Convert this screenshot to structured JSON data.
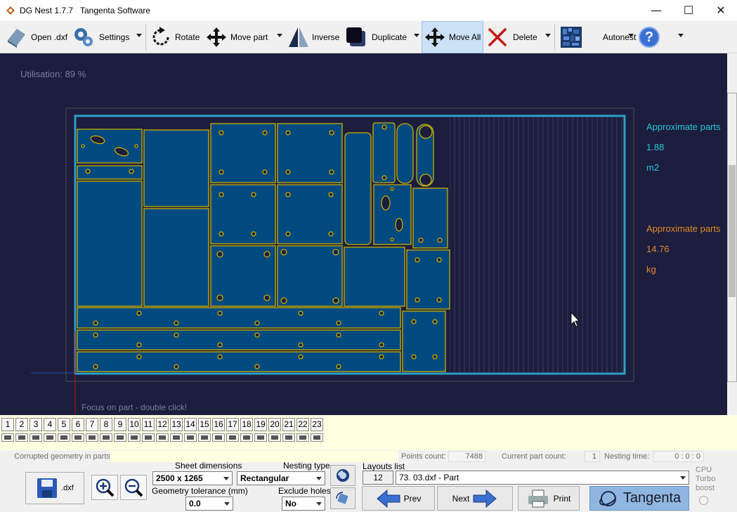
{
  "window": {
    "app_title": "DG Nest 1.7.7",
    "company": "Tangenta Software"
  },
  "window_controls": {
    "minimize": "—",
    "maximize": "☐",
    "close": "✕"
  },
  "toolbar": {
    "open_label": "Open .dxf",
    "settings_label": "Settings",
    "rotate_label": "Rotate",
    "move_part_label": "Move part",
    "inverse_label": "Inverse",
    "duplicate_label": "Duplicate",
    "move_all_label": "Move All",
    "delete_label": "Delete",
    "autonest_label": "Autonest",
    "help_label": "?"
  },
  "canvas": {
    "utilisation": "Utilisation: 89 %",
    "hint": "Focus on part - double click!",
    "area_label": "Approximate parts",
    "area_value": "1.88",
    "area_unit": "m2",
    "weight_label": "Approximate parts",
    "weight_value": "14.76",
    "weight_unit": "kg"
  },
  "layout_tabs": [
    "1",
    "2",
    "3",
    "4",
    "5",
    "6",
    "7",
    "8",
    "9",
    "10",
    "11",
    "12",
    "13",
    "14",
    "15",
    "16",
    "17",
    "18",
    "19",
    "20",
    "21",
    "22",
    "23"
  ],
  "info": {
    "corrupted_label": "Corrupted geometry in parts:",
    "points_label": "Points count:",
    "points_value": "7488",
    "part_count_label": "Current part count:",
    "part_count_value": "1",
    "nesting_time_label": "Nesting time:",
    "nesting_time_value": "0 : 0 : 0"
  },
  "bottom": {
    "save_dxf_label": ".dxf",
    "sheet_dimensions_label": "Sheet dimensions",
    "sheet_dimensions_value": "2500 x 1265",
    "geometry_tolerance_label": "Geometry tolerance (mm)",
    "geometry_tolerance_value": "0.0",
    "nesting_type_label": "Nesting type",
    "nesting_type_value": "Rectangular",
    "exclude_holes_label": "Exclude holes",
    "exclude_holes_value": "No",
    "layouts_list_label": "Layouts list",
    "layouts_count": "12",
    "layouts_selected": "73. 03.dxf - Part",
    "prev_label": "Prev",
    "next_label": "Next",
    "print_label": "Print",
    "brand_label": "Tangenta",
    "cpu_turbo_label_1": "CPU",
    "cpu_turbo_label_2": "Turbo",
    "cpu_turbo_label_3": "boost"
  },
  "colors": {
    "canvas_bg": "#1d1d3e",
    "part_fill": "#004a80",
    "part_outline": "#c8b000",
    "sheet_border": "#2aa0c8",
    "cyan_text": "#22c8d8",
    "orange_text": "#e08a2a",
    "accent": "#8fb6e0"
  }
}
